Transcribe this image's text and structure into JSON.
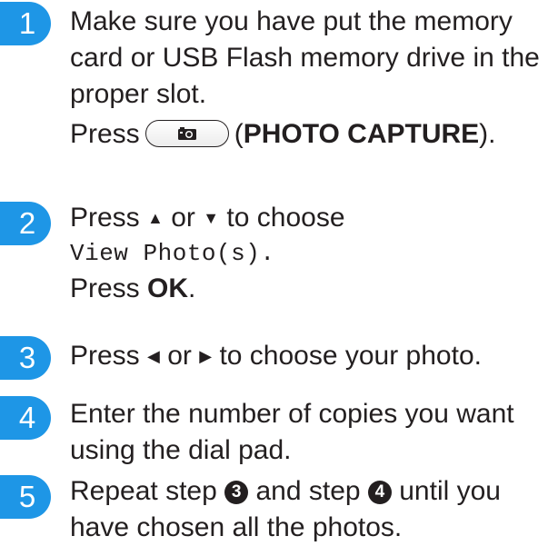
{
  "steps": [
    {
      "number": "1",
      "lines": [
        "Make sure you have put the memory",
        "card or USB Flash memory drive in the",
        "proper slot."
      ],
      "press_label": "Press",
      "button_icon": "camera-icon",
      "button_name_open": "(",
      "button_name": "PHOTO CAPTURE",
      "button_name_close": ")."
    },
    {
      "number": "2",
      "text_before": "Press",
      "up_arrow": "▲",
      "or_text": "or",
      "down_arrow": "▼",
      "text_after": "to choose",
      "menu_item": "View Photo(s).",
      "press_label": "Press",
      "ok_label": "OK",
      "period": "."
    },
    {
      "number": "3",
      "text_before": "Press",
      "left_arrow": "◀",
      "or_text": "or",
      "right_arrow": "▶",
      "text_after": "to choose your photo."
    },
    {
      "number": "4",
      "lines": [
        "Enter the number of copies you want",
        "using the dial pad."
      ]
    },
    {
      "number": "5",
      "text_a": "Repeat step",
      "ref_a": "3",
      "text_b": "and step",
      "ref_b": "4",
      "text_c": "until you",
      "line2": "have chosen all the photos."
    }
  ],
  "colors": {
    "badge": "#1e96e6",
    "text": "#231f20"
  }
}
